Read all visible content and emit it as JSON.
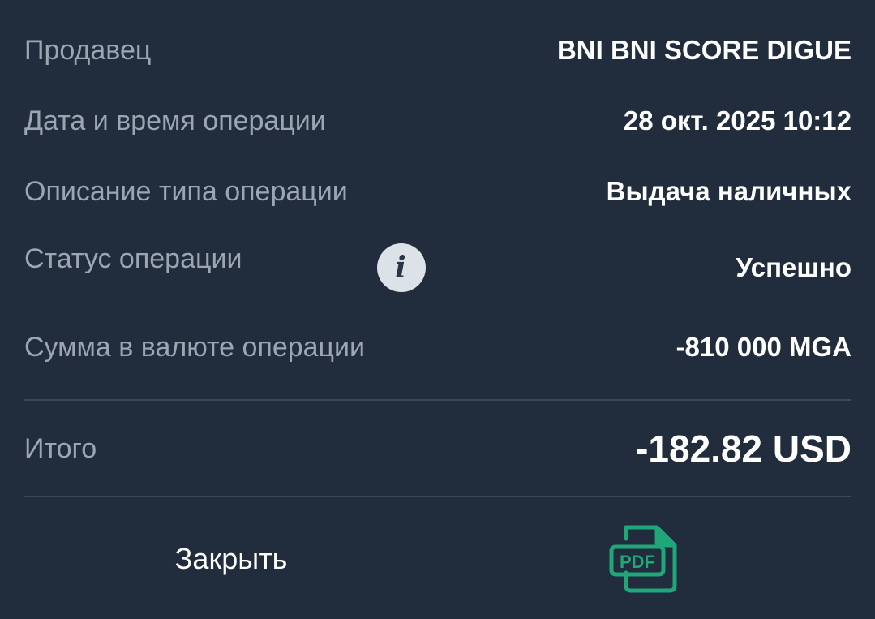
{
  "details": {
    "seller": {
      "label": "Продавец",
      "value": "BNI BNI SCORE DIGUE"
    },
    "datetime": {
      "label": "Дата и время операции",
      "value": "28 окт. 2025 10:12"
    },
    "op_type": {
      "label": "Описание типа операции",
      "value": "Выдача наличных"
    },
    "status": {
      "label": "Статус операции",
      "value": "Успешно",
      "info_icon": "info-icon",
      "info_glyph": "i"
    },
    "amount": {
      "label": "Сумма в валюте операции",
      "value": "-810 000 MGA"
    }
  },
  "total": {
    "label": "Итого",
    "value": "-182.82 USD"
  },
  "actions": {
    "close_label": "Закрыть",
    "pdf_icon": "pdf-icon",
    "pdf_text": "PDF"
  },
  "colors": {
    "background": "#212d3c",
    "label": "#9ba6b2",
    "value": "#ffffff",
    "divider": "#3b4756",
    "pdf_accent": "#1fa77a"
  }
}
